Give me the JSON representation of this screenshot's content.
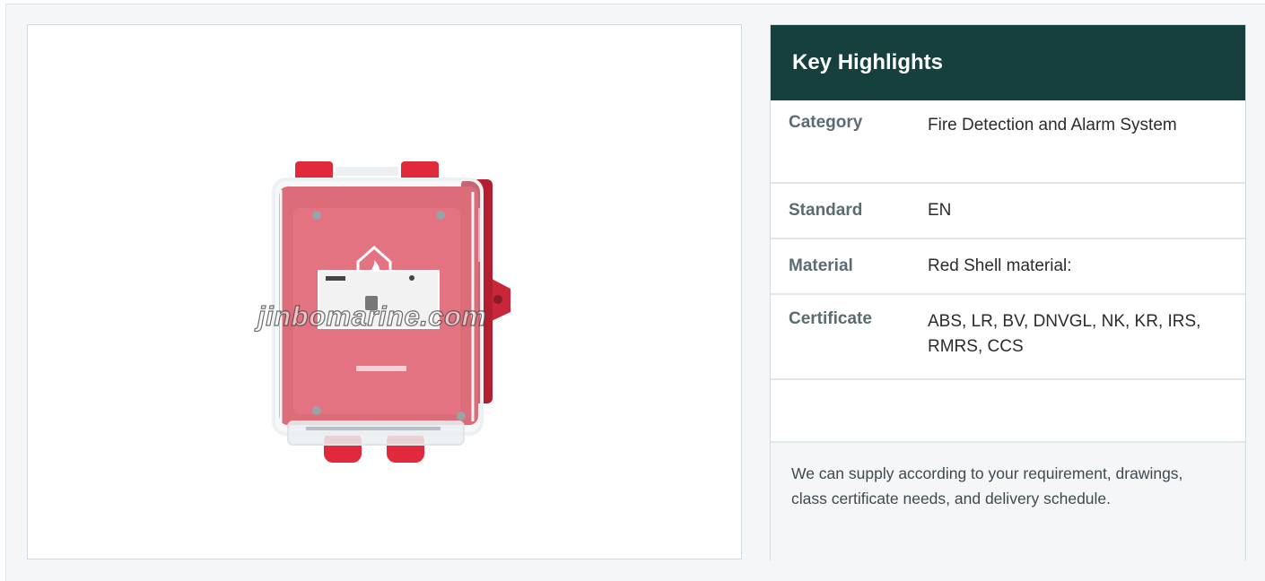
{
  "image": {
    "watermark": "jinbomarine.com",
    "alt": "Manual call point with transparent protective cover"
  },
  "highlights": {
    "title": "Key Highlights",
    "rows": [
      {
        "label": "Category",
        "value": "Fire Detection and Alarm System"
      },
      {
        "label": "Standard",
        "value": "EN"
      },
      {
        "label": "Material",
        "value": "Red Shell material:"
      },
      {
        "label": "Certificate",
        "value": "ABS, LR, BV, DNVGL, NK, KR, IRS, RMRS, CCS"
      },
      {
        "label": "",
        "value": ""
      }
    ],
    "note": "We can supply according to your requirement, drawings, class certificate needs, and delivery schedule."
  },
  "colors": {
    "header_bg": "#15403e",
    "panel_bg": "#f4f6f7",
    "border": "#cfdbe0",
    "product_red": "#d9283a"
  }
}
